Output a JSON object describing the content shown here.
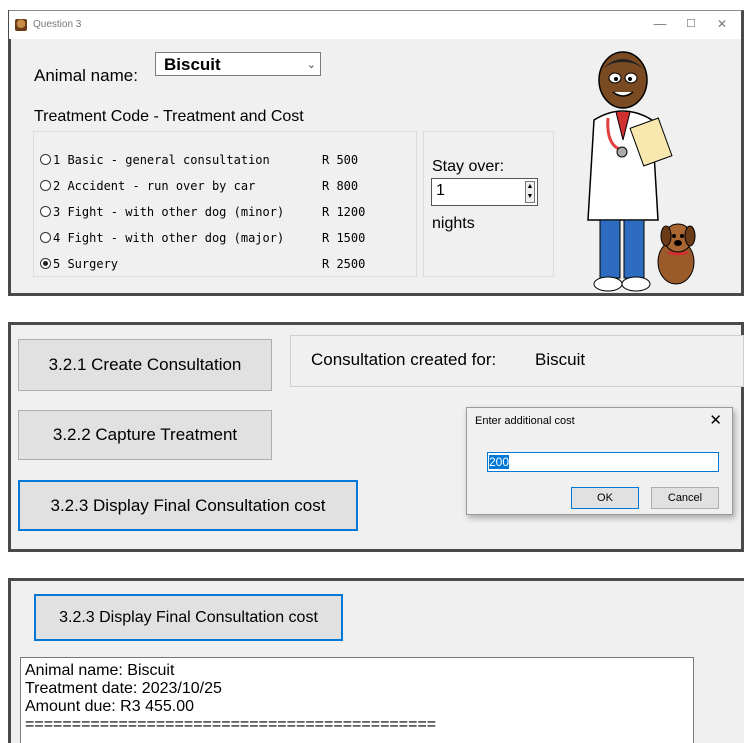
{
  "panel1": {
    "window_title": "Question 3",
    "win_controls": {
      "minimize": "—",
      "maximize": "☐",
      "close": "✕"
    },
    "animal_label": "Animal name:",
    "animal_value": "Biscuit",
    "treatment_heading": "Treatment Code - Treatment and Cost",
    "treatments": [
      {
        "label": "1 Basic - general consultation",
        "cost": "R 500",
        "selected": false
      },
      {
        "label": "2 Accident - run over by car",
        "cost": "R 800",
        "selected": false
      },
      {
        "label": "3 Fight - with other dog (minor)",
        "cost": "R 1200",
        "selected": false
      },
      {
        "label": "4 Fight - with other dog (major)",
        "cost": "R 1500",
        "selected": false
      },
      {
        "label": "5 Surgery",
        "cost": "R 2500",
        "selected": true
      }
    ],
    "stay_label": "Stay over:",
    "stay_value": "1",
    "nights_label": "nights"
  },
  "panel2": {
    "create_button": "3.2.1 Create Consultation",
    "capture_button": "3.2.2 Capture Treatment",
    "display_button": "3.2.3 Display Final Consultation cost",
    "consultation_label": "Consultation created for:",
    "consultation_name": "Biscuit",
    "dialog": {
      "title": "Enter additional cost",
      "close": "✕",
      "input_value": "200",
      "ok": "OK",
      "cancel": "Cancel"
    }
  },
  "panel3": {
    "display_button": "3.2.3 Display Final Consultation cost",
    "output_lines": [
      "Animal name: Biscuit",
      "Treatment date: 2023/10/25",
      "Amount due: R3 455.00",
      "============================================"
    ]
  }
}
